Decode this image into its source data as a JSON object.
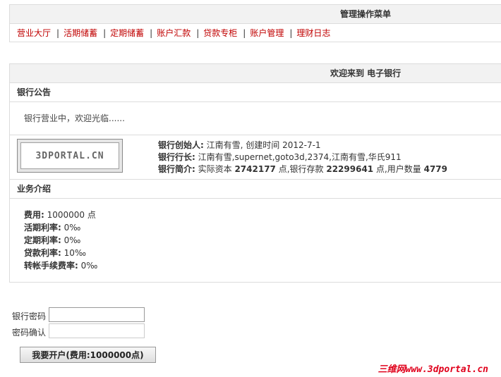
{
  "menu": {
    "title": "管理操作菜单",
    "items": [
      "营业大厅",
      "活期储蓄",
      "定期储蓄",
      "账户汇款",
      "贷款专柜",
      "账户管理",
      "理财日志"
    ]
  },
  "main": {
    "title": "欢迎来到 电子银行",
    "notice": {
      "header": "银行公告",
      "text": "银行营业中，欢迎光临......"
    },
    "info": {
      "logo_text": "3DPORTAL.CN",
      "founder_label": "银行创始人:",
      "founder_value": " 江南有雪, 创建时间 2012-7-1",
      "president_label": "银行行长:",
      "president_value": " 江南有雪,supernet,goto3d,2374,江南有雪,华氏911",
      "intro_label": "银行简介:",
      "intro_pre": " 实际资本 ",
      "capital": "2742177",
      "intro_mid": " 点,银行存款 ",
      "deposits": "22299641",
      "intro_mid2": " 点,用户数量 ",
      "users": "4779"
    },
    "business": {
      "header": "业务介绍",
      "rows": [
        {
          "label": "费用:",
          "value": " 1000000 点"
        },
        {
          "label": "活期利率:",
          "value": " 0‰"
        },
        {
          "label": "定期利率:",
          "value": " 0‰"
        },
        {
          "label": "贷款利率:",
          "value": " 10‰"
        },
        {
          "label": "转帐手续费率:",
          "value": " 0‰"
        }
      ]
    }
  },
  "form": {
    "password_label": "银行密码",
    "confirm_label": "密码确认",
    "password_value": "",
    "confirm_value": "",
    "submit_label": "我要开户(费用:1000000点)"
  },
  "watermark": "三维网www.3dportal.cn"
}
